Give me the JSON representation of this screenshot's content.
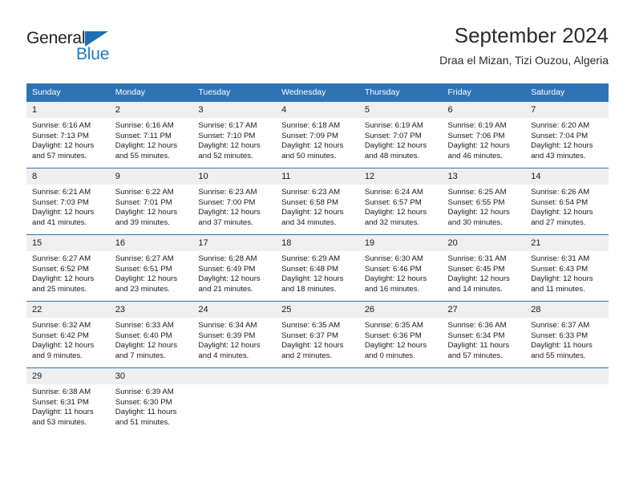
{
  "logo": {
    "word_top": "General",
    "word_bottom": "Blue",
    "triangle_icon": "triangle-icon",
    "color_dark": "#231f20",
    "color_blue": "#1f7ac4"
  },
  "header": {
    "title": "September 2024",
    "subtitle": "Draa el Mizan, Tizi Ouzou, Algeria"
  },
  "theme": {
    "header_blue": "#2e74b5",
    "daynum_gray": "#efefef",
    "text": "#1a1a1a"
  },
  "weekdays": [
    "Sunday",
    "Monday",
    "Tuesday",
    "Wednesday",
    "Thursday",
    "Friday",
    "Saturday"
  ],
  "weeks": [
    [
      {
        "day": "1",
        "sunrise": "Sunrise: 6:16 AM",
        "sunset": "Sunset: 7:13 PM",
        "daylight_line1": "Daylight: 12 hours",
        "daylight_line2": "and 57 minutes."
      },
      {
        "day": "2",
        "sunrise": "Sunrise: 6:16 AM",
        "sunset": "Sunset: 7:11 PM",
        "daylight_line1": "Daylight: 12 hours",
        "daylight_line2": "and 55 minutes."
      },
      {
        "day": "3",
        "sunrise": "Sunrise: 6:17 AM",
        "sunset": "Sunset: 7:10 PM",
        "daylight_line1": "Daylight: 12 hours",
        "daylight_line2": "and 52 minutes."
      },
      {
        "day": "4",
        "sunrise": "Sunrise: 6:18 AM",
        "sunset": "Sunset: 7:09 PM",
        "daylight_line1": "Daylight: 12 hours",
        "daylight_line2": "and 50 minutes."
      },
      {
        "day": "5",
        "sunrise": "Sunrise: 6:19 AM",
        "sunset": "Sunset: 7:07 PM",
        "daylight_line1": "Daylight: 12 hours",
        "daylight_line2": "and 48 minutes."
      },
      {
        "day": "6",
        "sunrise": "Sunrise: 6:19 AM",
        "sunset": "Sunset: 7:06 PM",
        "daylight_line1": "Daylight: 12 hours",
        "daylight_line2": "and 46 minutes."
      },
      {
        "day": "7",
        "sunrise": "Sunrise: 6:20 AM",
        "sunset": "Sunset: 7:04 PM",
        "daylight_line1": "Daylight: 12 hours",
        "daylight_line2": "and 43 minutes."
      }
    ],
    [
      {
        "day": "8",
        "sunrise": "Sunrise: 6:21 AM",
        "sunset": "Sunset: 7:03 PM",
        "daylight_line1": "Daylight: 12 hours",
        "daylight_line2": "and 41 minutes."
      },
      {
        "day": "9",
        "sunrise": "Sunrise: 6:22 AM",
        "sunset": "Sunset: 7:01 PM",
        "daylight_line1": "Daylight: 12 hours",
        "daylight_line2": "and 39 minutes."
      },
      {
        "day": "10",
        "sunrise": "Sunrise: 6:23 AM",
        "sunset": "Sunset: 7:00 PM",
        "daylight_line1": "Daylight: 12 hours",
        "daylight_line2": "and 37 minutes."
      },
      {
        "day": "11",
        "sunrise": "Sunrise: 6:23 AM",
        "sunset": "Sunset: 6:58 PM",
        "daylight_line1": "Daylight: 12 hours",
        "daylight_line2": "and 34 minutes."
      },
      {
        "day": "12",
        "sunrise": "Sunrise: 6:24 AM",
        "sunset": "Sunset: 6:57 PM",
        "daylight_line1": "Daylight: 12 hours",
        "daylight_line2": "and 32 minutes."
      },
      {
        "day": "13",
        "sunrise": "Sunrise: 6:25 AM",
        "sunset": "Sunset: 6:55 PM",
        "daylight_line1": "Daylight: 12 hours",
        "daylight_line2": "and 30 minutes."
      },
      {
        "day": "14",
        "sunrise": "Sunrise: 6:26 AM",
        "sunset": "Sunset: 6:54 PM",
        "daylight_line1": "Daylight: 12 hours",
        "daylight_line2": "and 27 minutes."
      }
    ],
    [
      {
        "day": "15",
        "sunrise": "Sunrise: 6:27 AM",
        "sunset": "Sunset: 6:52 PM",
        "daylight_line1": "Daylight: 12 hours",
        "daylight_line2": "and 25 minutes."
      },
      {
        "day": "16",
        "sunrise": "Sunrise: 6:27 AM",
        "sunset": "Sunset: 6:51 PM",
        "daylight_line1": "Daylight: 12 hours",
        "daylight_line2": "and 23 minutes."
      },
      {
        "day": "17",
        "sunrise": "Sunrise: 6:28 AM",
        "sunset": "Sunset: 6:49 PM",
        "daylight_line1": "Daylight: 12 hours",
        "daylight_line2": "and 21 minutes."
      },
      {
        "day": "18",
        "sunrise": "Sunrise: 6:29 AM",
        "sunset": "Sunset: 6:48 PM",
        "daylight_line1": "Daylight: 12 hours",
        "daylight_line2": "and 18 minutes."
      },
      {
        "day": "19",
        "sunrise": "Sunrise: 6:30 AM",
        "sunset": "Sunset: 6:46 PM",
        "daylight_line1": "Daylight: 12 hours",
        "daylight_line2": "and 16 minutes."
      },
      {
        "day": "20",
        "sunrise": "Sunrise: 6:31 AM",
        "sunset": "Sunset: 6:45 PM",
        "daylight_line1": "Daylight: 12 hours",
        "daylight_line2": "and 14 minutes."
      },
      {
        "day": "21",
        "sunrise": "Sunrise: 6:31 AM",
        "sunset": "Sunset: 6:43 PM",
        "daylight_line1": "Daylight: 12 hours",
        "daylight_line2": "and 11 minutes."
      }
    ],
    [
      {
        "day": "22",
        "sunrise": "Sunrise: 6:32 AM",
        "sunset": "Sunset: 6:42 PM",
        "daylight_line1": "Daylight: 12 hours",
        "daylight_line2": "and 9 minutes."
      },
      {
        "day": "23",
        "sunrise": "Sunrise: 6:33 AM",
        "sunset": "Sunset: 6:40 PM",
        "daylight_line1": "Daylight: 12 hours",
        "daylight_line2": "and 7 minutes."
      },
      {
        "day": "24",
        "sunrise": "Sunrise: 6:34 AM",
        "sunset": "Sunset: 6:39 PM",
        "daylight_line1": "Daylight: 12 hours",
        "daylight_line2": "and 4 minutes."
      },
      {
        "day": "25",
        "sunrise": "Sunrise: 6:35 AM",
        "sunset": "Sunset: 6:37 PM",
        "daylight_line1": "Daylight: 12 hours",
        "daylight_line2": "and 2 minutes."
      },
      {
        "day": "26",
        "sunrise": "Sunrise: 6:35 AM",
        "sunset": "Sunset: 6:36 PM",
        "daylight_line1": "Daylight: 12 hours",
        "daylight_line2": "and 0 minutes."
      },
      {
        "day": "27",
        "sunrise": "Sunrise: 6:36 AM",
        "sunset": "Sunset: 6:34 PM",
        "daylight_line1": "Daylight: 11 hours",
        "daylight_line2": "and 57 minutes."
      },
      {
        "day": "28",
        "sunrise": "Sunrise: 6:37 AM",
        "sunset": "Sunset: 6:33 PM",
        "daylight_line1": "Daylight: 11 hours",
        "daylight_line2": "and 55 minutes."
      }
    ],
    [
      {
        "day": "29",
        "sunrise": "Sunrise: 6:38 AM",
        "sunset": "Sunset: 6:31 PM",
        "daylight_line1": "Daylight: 11 hours",
        "daylight_line2": "and 53 minutes."
      },
      {
        "day": "30",
        "sunrise": "Sunrise: 6:39 AM",
        "sunset": "Sunset: 6:30 PM",
        "daylight_line1": "Daylight: 11 hours",
        "daylight_line2": "and 51 minutes."
      },
      {
        "day": "",
        "sunrise": "",
        "sunset": "",
        "daylight_line1": "",
        "daylight_line2": ""
      },
      {
        "day": "",
        "sunrise": "",
        "sunset": "",
        "daylight_line1": "",
        "daylight_line2": ""
      },
      {
        "day": "",
        "sunrise": "",
        "sunset": "",
        "daylight_line1": "",
        "daylight_line2": ""
      },
      {
        "day": "",
        "sunrise": "",
        "sunset": "",
        "daylight_line1": "",
        "daylight_line2": ""
      },
      {
        "day": "",
        "sunrise": "",
        "sunset": "",
        "daylight_line1": "",
        "daylight_line2": ""
      }
    ]
  ]
}
